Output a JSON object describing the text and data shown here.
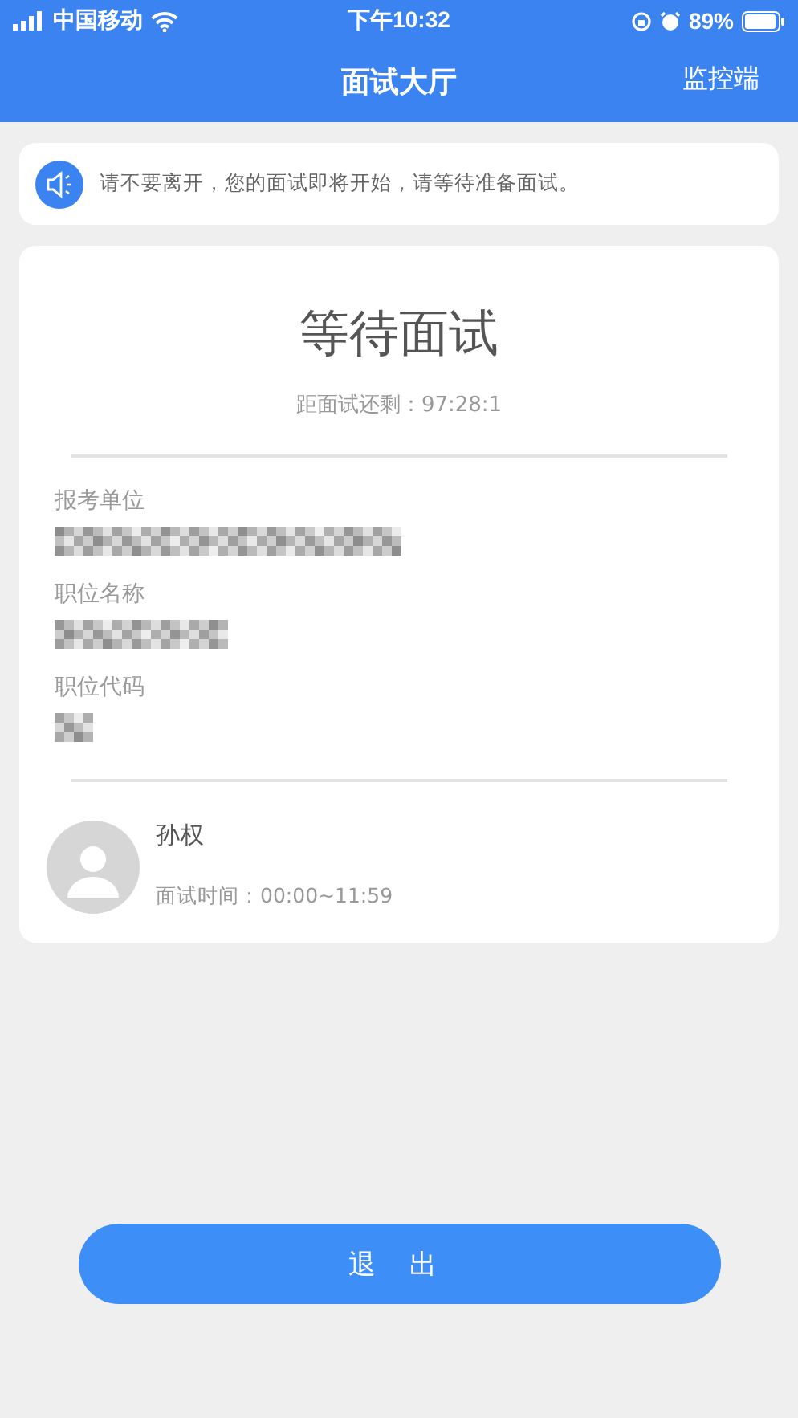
{
  "status_bar": {
    "carrier": "中国移动",
    "time": "下午10:32",
    "battery": "89%"
  },
  "nav": {
    "title": "面试大厅",
    "action": "监控端"
  },
  "notice": {
    "text": "请不要离开，您的面试即将开始，请等待准备面试。"
  },
  "card": {
    "title": "等待面试",
    "countdown": "距面试还剩：97:28:1",
    "fields": [
      {
        "label": "报考单位",
        "redacted": true
      },
      {
        "label": "职位名称",
        "redacted": true
      },
      {
        "label": "职位代码",
        "redacted": true
      }
    ],
    "candidate": {
      "name": "孙权",
      "time": "面试时间：00:00~11:59"
    }
  },
  "button": "退 出"
}
